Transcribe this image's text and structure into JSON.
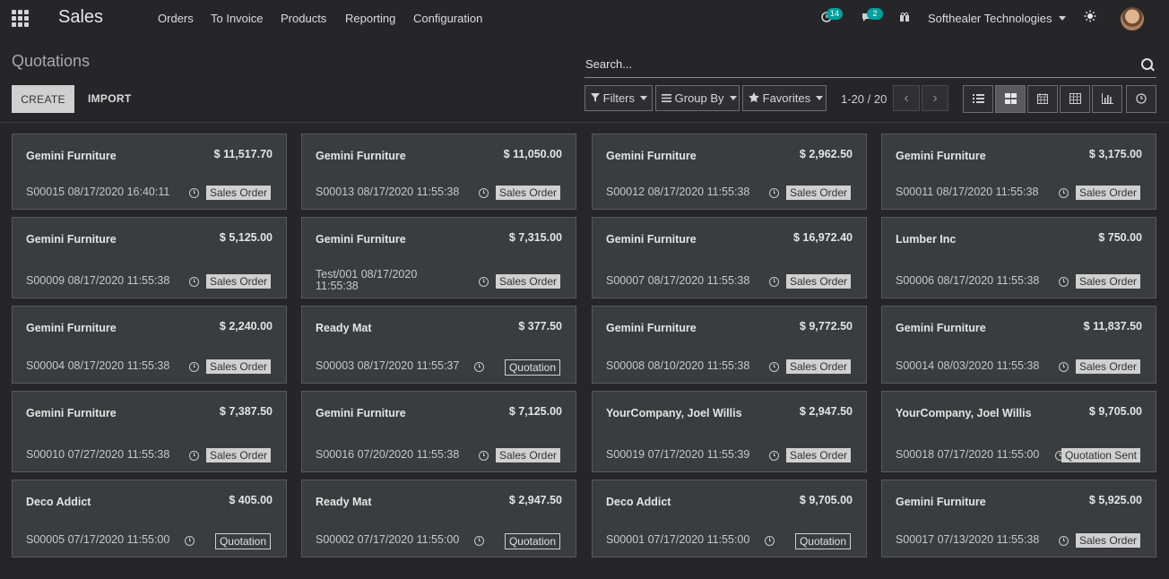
{
  "navbar": {
    "app_name": "Sales",
    "menu": [
      "Orders",
      "To Invoice",
      "Products",
      "Reporting",
      "Configuration"
    ],
    "activity_badge": "14",
    "messages_badge": "2",
    "company": "Softhealer Technologies",
    "icons": {
      "apps": "apps-grid-icon",
      "activity": "clock-icon",
      "messages": "chat-icon",
      "gift": "gift-icon",
      "theme": "sun-icon"
    }
  },
  "control_panel": {
    "title": "Quotations",
    "create_label": "CREATE",
    "import_label": "IMPORT",
    "search_placeholder": "Search...",
    "filters_label": "Filters",
    "groupby_label": "Group By",
    "favorites_label": "Favorites",
    "pager": "1-20 / 20",
    "views": [
      "list",
      "kanban",
      "calendar",
      "pivot",
      "graph",
      "activity"
    ]
  },
  "cards": [
    {
      "customer": "Gemini Furniture",
      "amount": "$ 11,517.70",
      "ref": "S00015 08/17/2020 16:40:11",
      "state": "Sales Order"
    },
    {
      "customer": "Gemini Furniture",
      "amount": "$ 11,050.00",
      "ref": "S00013 08/17/2020 11:55:38",
      "state": "Sales Order"
    },
    {
      "customer": "Gemini Furniture",
      "amount": "$ 2,962.50",
      "ref": "S00012 08/17/2020 11:55:38",
      "state": "Sales Order"
    },
    {
      "customer": "Gemini Furniture",
      "amount": "$ 3,175.00",
      "ref": "S00011 08/17/2020 11:55:38",
      "state": "Sales Order"
    },
    {
      "customer": "Gemini Furniture",
      "amount": "$ 5,125.00",
      "ref": "S00009 08/17/2020 11:55:38",
      "state": "Sales Order"
    },
    {
      "customer": "Gemini Furniture",
      "amount": "$ 7,315.00",
      "ref": "Test/001 08/17/2020 11:55:38",
      "state": "Sales Order"
    },
    {
      "customer": "Gemini Furniture",
      "amount": "$ 16,972.40",
      "ref": "S00007 08/17/2020 11:55:38",
      "state": "Sales Order"
    },
    {
      "customer": "Lumber Inc",
      "amount": "$ 750.00",
      "ref": "S00006 08/17/2020 11:55:38",
      "state": "Sales Order"
    },
    {
      "customer": "Gemini Furniture",
      "amount": "$ 2,240.00",
      "ref": "S00004 08/17/2020 11:55:38",
      "state": "Sales Order"
    },
    {
      "customer": "Ready Mat",
      "amount": "$ 377.50",
      "ref": "S00003 08/17/2020 11:55:37",
      "state": "Quotation"
    },
    {
      "customer": "Gemini Furniture",
      "amount": "$ 9,772.50",
      "ref": "S00008 08/10/2020 11:55:38",
      "state": "Sales Order"
    },
    {
      "customer": "Gemini Furniture",
      "amount": "$ 11,837.50",
      "ref": "S00014 08/03/2020 11:55:38",
      "state": "Sales Order"
    },
    {
      "customer": "Gemini Furniture",
      "amount": "$ 7,387.50",
      "ref": "S00010 07/27/2020 11:55:38",
      "state": "Sales Order"
    },
    {
      "customer": "Gemini Furniture",
      "amount": "$ 7,125.00",
      "ref": "S00016 07/20/2020 11:55:38",
      "state": "Sales Order"
    },
    {
      "customer": "YourCompany, Joel Willis",
      "amount": "$ 2,947.50",
      "ref": "S00019 07/17/2020 11:55:39",
      "state": "Sales Order"
    },
    {
      "customer": "YourCompany, Joel Willis",
      "amount": "$ 9,705.00",
      "ref": "S00018 07/17/2020 11:55:00",
      "state": "Quotation Sent"
    },
    {
      "customer": "Deco Addict",
      "amount": "$ 405.00",
      "ref": "S00005 07/17/2020 11:55:00",
      "state": "Quotation"
    },
    {
      "customer": "Ready Mat",
      "amount": "$ 2,947.50",
      "ref": "S00002 07/17/2020 11:55:00",
      "state": "Quotation"
    },
    {
      "customer": "Deco Addict",
      "amount": "$ 9,705.00",
      "ref": "S00001 07/17/2020 11:55:00",
      "state": "Quotation"
    },
    {
      "customer": "Gemini Furniture",
      "amount": "$ 5,925.00",
      "ref": "S00017 07/13/2020 11:55:38",
      "state": "Sales Order"
    }
  ]
}
